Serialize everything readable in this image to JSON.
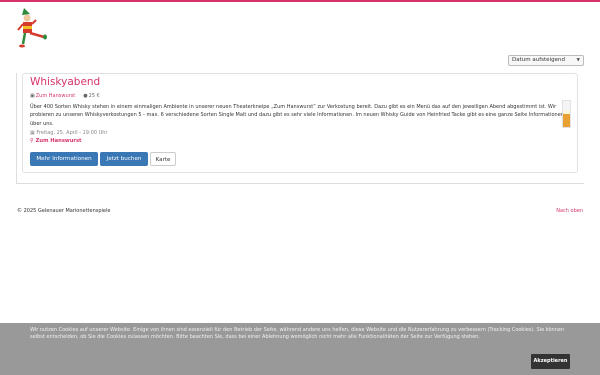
{
  "sort": {
    "selected": "Datum aufsteigend"
  },
  "event": {
    "title": "Whiskyabend",
    "venue_tag": "Zum Hanswurst",
    "price": "25 €",
    "description": "Über 400 Sorten Whisky stehen in einem einmaligen Ambiente in unserer neuen Theaterkneipe „Zum Hanswurst“ zur Verkostung bereit. Dazu gibt es ein Menü das auf den jeweiligen Abend abgestimmt ist. Wir probieren zu unseren Whiskyverkostungen 5 - max. 6 verschiedene Sorten Single Malt und dazu gibt es sehr viele Informationen. Im neuen Whisky Guide von Heinfried Tacke gibt es eine ganze Seite Informationen über uns.",
    "date": "Freitag, 25. April - 19:00 Uhr",
    "venue": "Zum Hanswurst",
    "buttons": {
      "info": "Mehr Informationen",
      "book": "Jetzt buchen",
      "map": "Karte"
    }
  },
  "footer": {
    "copyright": "© 2025 Gelenauer Marionettenspiele",
    "back_to_top": "Nach oben"
  },
  "cookie": {
    "text": "Wir nutzen Cookies auf unserer Website. Einige von ihnen sind essenziell für den Betrieb der Seite, während andere uns helfen, diese Website und die Nutzererfahrung zu verbessern (Tracking Cookies). Sie können selbst entscheiden, ob Sie die Cookies zulassen möchten. Bitte beachten Sie, dass bei einer Ablehnung womöglich nicht mehr alle Funktionalitäten der Seite zur Verfügung stehen.",
    "accept": "Akzeptieren"
  },
  "colors": {
    "accent": "#d6336c",
    "button": "#3a78b5",
    "cookie_bg": "#999999"
  }
}
